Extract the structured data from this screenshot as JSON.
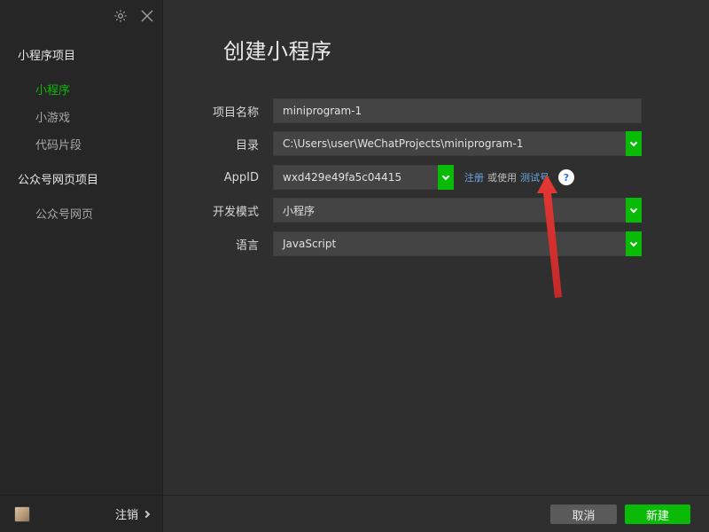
{
  "sidebar": {
    "sections": [
      {
        "title": "小程序项目",
        "items": [
          {
            "label": "小程序",
            "active": true
          },
          {
            "label": "小游戏"
          },
          {
            "label": "代码片段"
          }
        ]
      },
      {
        "title": "公众号网页项目",
        "items": [
          {
            "label": "公众号网页"
          }
        ]
      }
    ],
    "top_icons": [
      "gear-icon",
      "close-icon"
    ],
    "footer": {
      "logout_label": "注销"
    }
  },
  "main": {
    "title": "创建小程序",
    "form": {
      "project_name": {
        "label": "项目名称",
        "value": "miniprogram-1"
      },
      "directory": {
        "label": "目录",
        "value": "C:\\Users\\user\\WeChatProjects\\miniprogram-1"
      },
      "appid": {
        "label": "AppID",
        "value": "wxd429e49fa5c04415",
        "register_link": "注册",
        "or_use_text": "或使用",
        "test_account_link": "测试号",
        "help_text": "?"
      },
      "dev_mode": {
        "label": "开发模式",
        "value": "小程序"
      },
      "language": {
        "label": "语言",
        "value": "JavaScript"
      }
    }
  },
  "footer": {
    "cancel_label": "取消",
    "create_label": "新建"
  },
  "colors": {
    "accent": "#09bb07",
    "background": "#2f2f2f",
    "sidebar": "#262626",
    "field": "#444444",
    "link": "#6aa6e8",
    "annotation_arrow": "#e53935"
  }
}
